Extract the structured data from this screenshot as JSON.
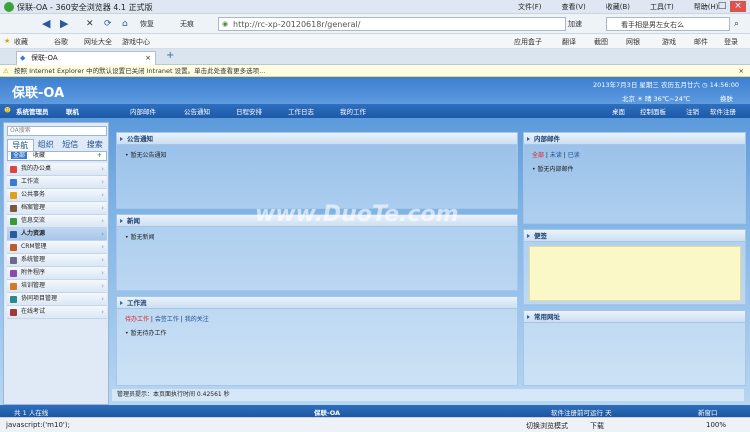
{
  "browser": {
    "title": "保联-OA - 360安全浏览器 4.1 正式版",
    "menus": [
      "文件(F)",
      "查看(V)",
      "收藏(B)",
      "工具(T)",
      "帮助(H)"
    ],
    "nav": {
      "restore": "恢复",
      "no_image": "无痕",
      "url": "http://rc-xp-20120618r/general/",
      "accelerate": "加速",
      "search_text": "看手相是男左女右么"
    },
    "favorites": [
      "收藏",
      "谷歌",
      "网址大全",
      "游戏中心"
    ],
    "toolbar_right": [
      "应用盒子",
      "翻译",
      "截图",
      "网银",
      "游戏",
      "邮件",
      "登录"
    ],
    "tab_label": "保联-OA",
    "infobar": "按照 Internet Explorer 中的默认设置已关闭 Intranet 设置。单击此处查看更多选项..."
  },
  "oa": {
    "logo": "保联-OA",
    "date": "2013年7月3日 星期三 农历五月廿六",
    "time": "14:56:00",
    "city": "北京",
    "weather": "晴 36℃~24℃",
    "skin": "换肤",
    "user": "系统管理员",
    "status": "联机",
    "topnav": [
      "内部邮件",
      "公告通知",
      "日程安排",
      "工作日志",
      "我的工作"
    ],
    "topnav_right": [
      "桌面",
      "控制面板",
      "注销",
      "软件注册"
    ],
    "left": {
      "search_placeholder": "OA搜索",
      "tabs": [
        "导航",
        "组织",
        "短信",
        "搜索"
      ],
      "subtabs": [
        "全部",
        "收藏"
      ],
      "menu": [
        "我的办公桌",
        "工作流",
        "公共事务",
        "档案管理",
        "信息交流",
        "人力资源",
        "CRM管理",
        "系统管理",
        "附件程序",
        "培训管理",
        "协同项目管理",
        "在线考试"
      ]
    },
    "panels": {
      "notice": {
        "title": "公告通知",
        "empty": "暂无公告通知"
      },
      "news": {
        "title": "新闻",
        "empty": "暂无新闻"
      },
      "workflow": {
        "title": "工作流",
        "tabs": [
          "待办工作",
          "会签工作",
          "我的关注"
        ],
        "empty": "暂无待办工作"
      },
      "mail": {
        "title": "内部邮件",
        "tabs": [
          "全部",
          "未读",
          "已读"
        ],
        "empty": "暂无内部邮件"
      },
      "memo": {
        "title": "便签"
      },
      "links": {
        "title": "常用网址"
      }
    },
    "admin_tip": "管理员提示：本页面执行时间 0.42561 秒",
    "footer": {
      "online_prefix": "共",
      "online_count": "1",
      "online_suffix": "人在线",
      "center": "保联-OA",
      "register": "软件注册前可运行",
      "days": "天",
      "close": "新窗口"
    }
  },
  "watermark": "www.DuoTe.com",
  "status": {
    "script": "javascript:('m10');",
    "mode": "切换浏览模式",
    "download": "下载",
    "zoom": "100%"
  }
}
